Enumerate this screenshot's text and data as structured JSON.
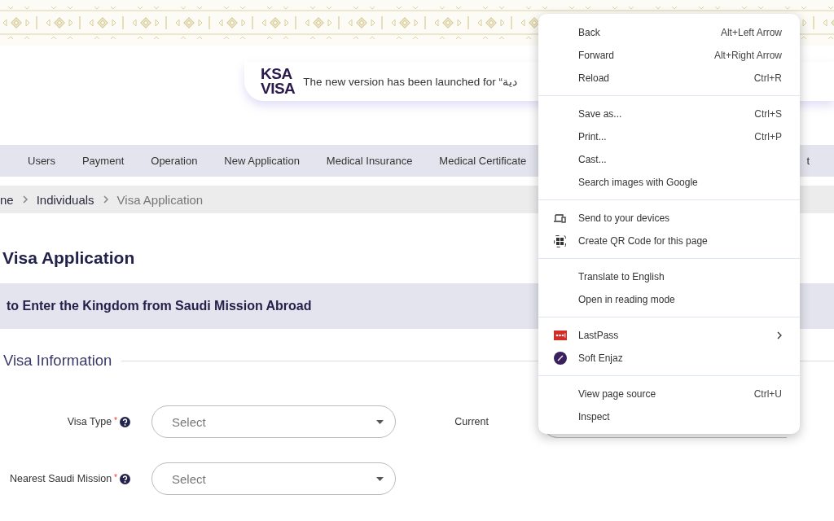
{
  "banner": {
    "logo": [
      "KSA",
      "VISA"
    ],
    "message": "The new version has been launched for “دية"
  },
  "nav": {
    "items": [
      "Users",
      "Payment",
      "Operation",
      "New Application",
      "Medical Insurance",
      "Medical Certificate"
    ],
    "trailing": "t"
  },
  "breadcrumb": [
    "ne",
    "Individuals",
    "Visa Application"
  ],
  "page_title": "Visa Application",
  "section_heading": "to Enter the Kingdom from Saudi Mission Abroad",
  "fieldset": {
    "legend": "Visa Information",
    "fields": [
      {
        "label": "Visa Type",
        "required_mark": "*",
        "placeholder": "Select"
      },
      {
        "label": "Nearest Saudi Mission",
        "required_mark": "*",
        "placeholder": "Select"
      }
    ],
    "side_field": {
      "label": "Current"
    }
  },
  "context_menu": {
    "groups": [
      [
        {
          "label": "Back",
          "shortcut": "Alt+Left Arrow"
        },
        {
          "label": "Forward",
          "shortcut": "Alt+Right Arrow"
        },
        {
          "label": "Reload",
          "shortcut": "Ctrl+R"
        }
      ],
      [
        {
          "label": "Save as...",
          "shortcut": "Ctrl+S"
        },
        {
          "label": "Print...",
          "shortcut": "Ctrl+P"
        },
        {
          "label": "Cast..."
        },
        {
          "label": "Search images with Google"
        }
      ],
      [
        {
          "label": "Send to your devices",
          "kind": "devices"
        },
        {
          "label": "Create QR Code for this page",
          "kind": "qr"
        }
      ],
      [
        {
          "label": "Translate to English"
        },
        {
          "label": "Open in reading mode"
        }
      ],
      [
        {
          "label": "LastPass",
          "kind": "lastpass",
          "submenu": true
        },
        {
          "label": "Soft Enjaz",
          "kind": "enjaz",
          "submenu": false
        }
      ],
      [
        {
          "label": "View page source",
          "shortcut": "Ctrl+U"
        },
        {
          "label": "Inspect"
        }
      ]
    ]
  }
}
